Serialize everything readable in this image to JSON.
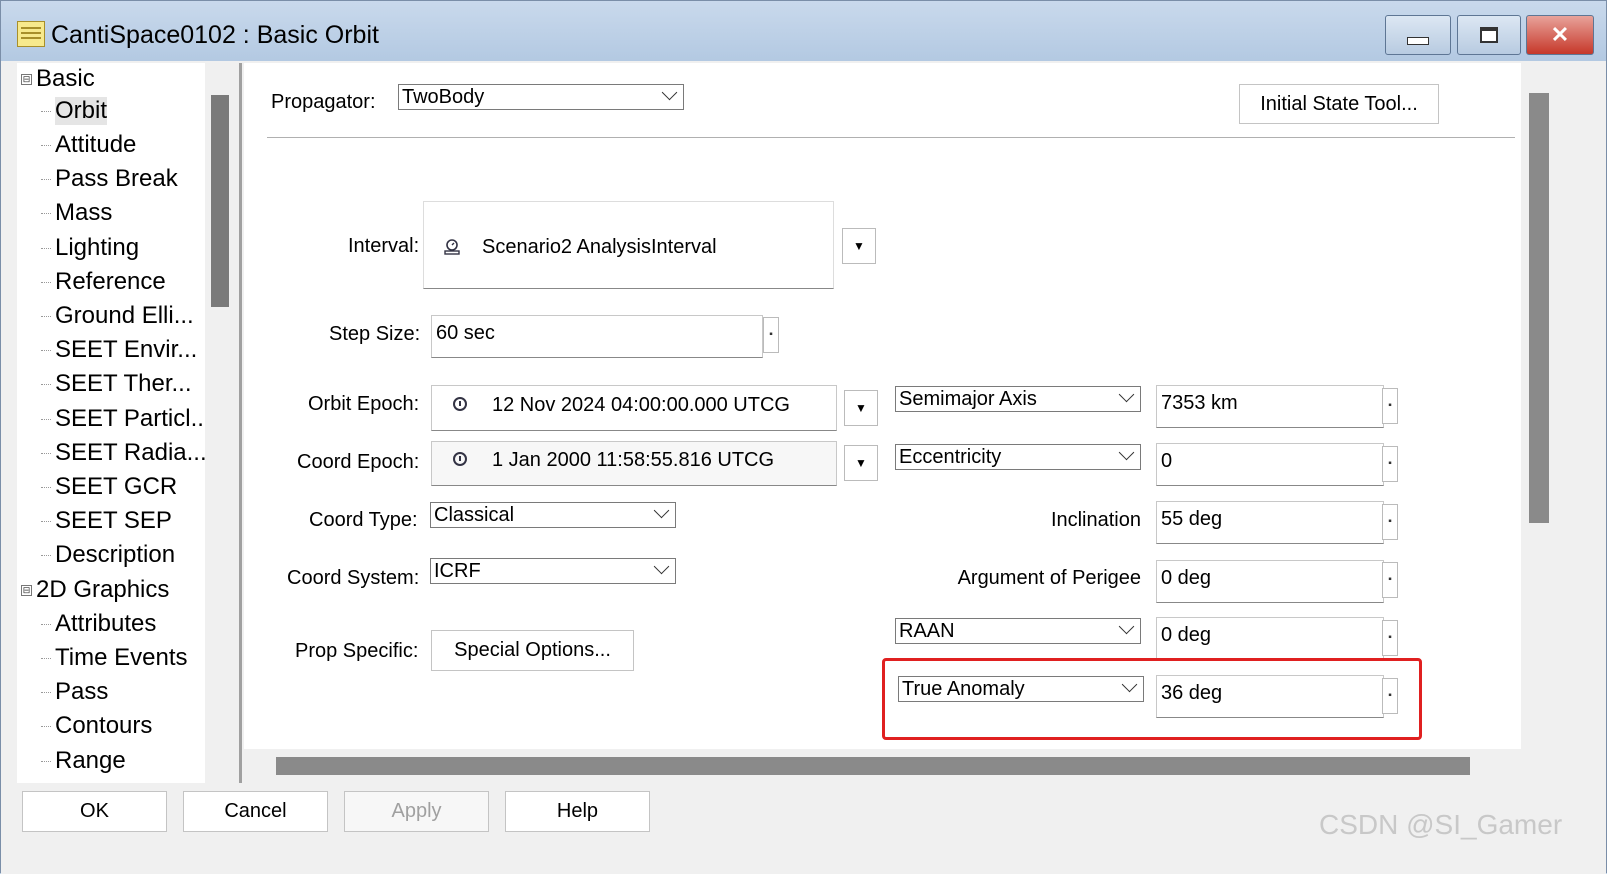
{
  "window": {
    "title": "CantiSpace0102 : Basic Orbit",
    "controls": {
      "minimize": "minimize-icon",
      "maximize": "maximize-icon",
      "close": "✕"
    }
  },
  "tree": {
    "groups": [
      {
        "label": "Basic",
        "expander": "⊟",
        "items": [
          "Orbit",
          "Attitude",
          "Pass Break",
          "Mass",
          "Lighting",
          "Reference",
          "Ground Elli...",
          "SEET Envir...",
          "SEET Ther...",
          "SEET Particl...",
          "SEET Radia...",
          "SEET GCR",
          "SEET SEP",
          "Description"
        ]
      },
      {
        "label": "2D Graphics",
        "expander": "⊟",
        "items": [
          "Attributes",
          "Time Events",
          "Pass",
          "Contours",
          "Range"
        ]
      }
    ],
    "selected": "Orbit"
  },
  "propagator": {
    "label": "Propagator:",
    "value": "TwoBody"
  },
  "initial_state_button": "Initial State Tool...",
  "interval": {
    "label": "Interval:",
    "value": "Scenario2 AnalysisInterval",
    "icon": "interval-icon"
  },
  "step_size": {
    "label": "Step Size:",
    "value": "60 sec"
  },
  "orbit_epoch": {
    "label": "Orbit Epoch:",
    "value": "12 Nov 2024 04:00:00.000 UTCG",
    "icon": "clock-icon"
  },
  "coord_epoch": {
    "label": "Coord Epoch:",
    "value": "1 Jan 2000 11:58:55.816 UTCG",
    "icon": "clock-icon"
  },
  "coord_type": {
    "label": "Coord Type:",
    "value": "Classical"
  },
  "coord_system": {
    "label": "Coord System:",
    "value": "ICRF"
  },
  "prop_specific": {
    "label": "Prop Specific:",
    "button": "Special Options..."
  },
  "elements": [
    {
      "name": "Semimajor Axis",
      "selectable": true,
      "value": "7353 km"
    },
    {
      "name": "Eccentricity",
      "selectable": true,
      "value": "0"
    },
    {
      "name": "Inclination",
      "selectable": false,
      "value": "55 deg"
    },
    {
      "name": "Argument of Perigee",
      "selectable": false,
      "value": "0 deg"
    },
    {
      "name": "RAAN",
      "selectable": true,
      "value": "0 deg"
    },
    {
      "name": "True Anomaly",
      "selectable": true,
      "value": "36 deg"
    }
  ],
  "buttons": {
    "ok": "OK",
    "cancel": "Cancel",
    "apply": "Apply",
    "help": "Help"
  },
  "watermark": "CSDN @SI_Gamer",
  "colors": {
    "highlight": "#e02020",
    "titlebar": "#b3c9e2"
  }
}
